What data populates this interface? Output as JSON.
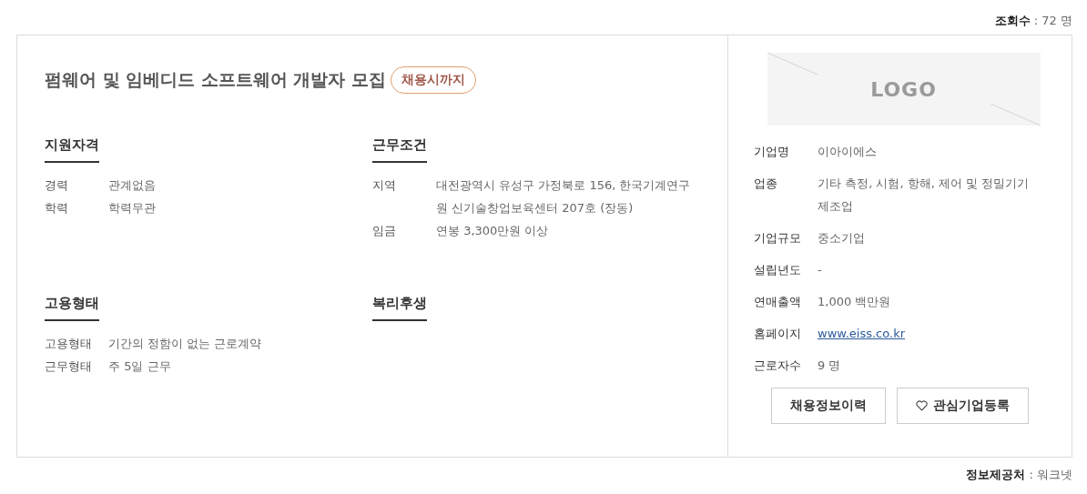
{
  "views": {
    "label": "조회수",
    "value": ": 72 명"
  },
  "job": {
    "title": "펌웨어 및 임베디드 소프트웨어 개발자 모집",
    "badge": "채용시까지"
  },
  "sections": [
    {
      "heading": "지원자격",
      "rows": [
        {
          "label": "경력",
          "value": "관계없음"
        },
        {
          "label": "학력",
          "value": "학력무관"
        }
      ]
    },
    {
      "heading": "근무조건",
      "rows": [
        {
          "label": "지역",
          "value": "대전광역시 유성구 가정북로 156, 한국기계연구원 신기술창업보육센터 207호 (장동)"
        },
        {
          "label": "임금",
          "value": "연봉 3,300만원 이상"
        }
      ]
    },
    {
      "heading": "고용형태",
      "rows": [
        {
          "label": "고용형태",
          "value": "기간의 정함이 없는 근로계약"
        },
        {
          "label": "근무형태",
          "value": "주 5일 근무"
        }
      ]
    },
    {
      "heading": "복리후생"
    }
  ],
  "company": {
    "logo_text": "LOGO",
    "rows": [
      {
        "label": "기업명",
        "value": "이아이에스",
        "kind": "text"
      },
      {
        "label": "업종",
        "value": "기타 측정, 시험, 항해, 제어 및 정밀기기 제조업",
        "kind": "text"
      },
      {
        "label": "기업규모",
        "value": "중소기업",
        "kind": "text"
      },
      {
        "label": "설립년도",
        "value": "-",
        "kind": "text"
      },
      {
        "label": "연매출액",
        "value": "1,000 백만원",
        "kind": "text"
      },
      {
        "label": "홈페이지",
        "value": "www.eiss.co.kr",
        "kind": "link"
      },
      {
        "label": "근로자수",
        "value": "9 명",
        "kind": "text"
      }
    ],
    "buttons": [
      {
        "label": "채용정보이력",
        "kind": "plain"
      },
      {
        "label": "관심기업등록",
        "kind": "heart"
      }
    ]
  },
  "source": {
    "label": "정보제공처",
    "value": ": 워크넷"
  }
}
